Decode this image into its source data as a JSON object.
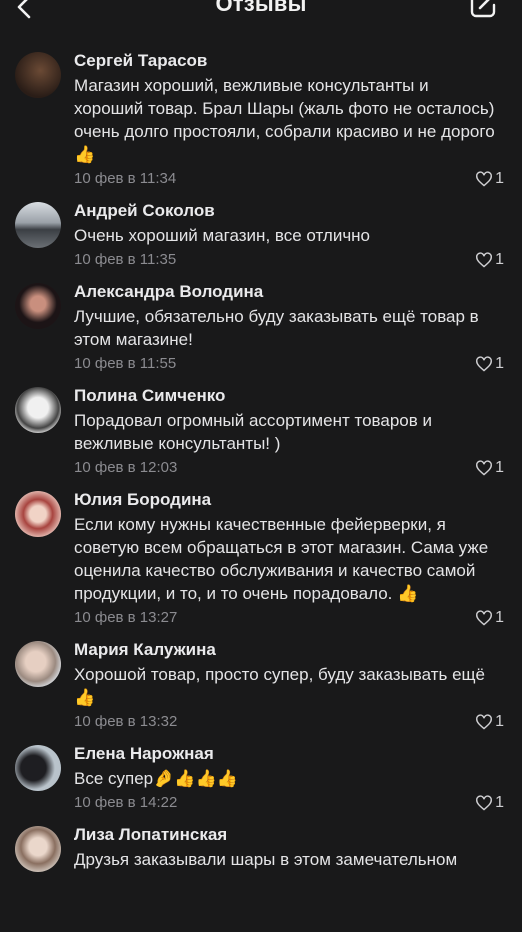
{
  "header": {
    "title": "Отзывы",
    "back_icon": "chevron-left-icon",
    "edit_icon": "edit-square-icon"
  },
  "reviews": [
    {
      "name": "Сергей Тарасов",
      "text": "Магазин хороший, вежливые консультанты и хороший товар. Брал Шары (жаль фото не осталось) очень долго простояли, собрали красиво и не дорого👍",
      "time": "10 фев в 11:34",
      "likes": "1",
      "avatar_color": "#3a2a22"
    },
    {
      "name": "Андрей Соколов",
      "text": "Очень хороший магазин, все отлично",
      "time": "10 фев в 11:35",
      "likes": "1",
      "avatar_color": "#8a8f95"
    },
    {
      "name": "Александра Володина",
      "text": "Лучшие, обязательно буду заказывать ещё товар в этом магазине!",
      "time": "10 фев в 11:55",
      "likes": "1",
      "avatar_color": "#2b2024"
    },
    {
      "name": "Полина Симченко",
      "text": "Порадовал огромный ассортимент товаров и вежливые консультанты! )",
      "time": "10 фев в 12:03",
      "likes": "1",
      "avatar_color": "#d9d9d9"
    },
    {
      "name": "Юлия Бородина",
      "text": "Если кому нужны качественные фейерверки, я советую всем обращаться в этот магазин. Сама уже оценила качество обслуживания и качество самой продукции, и то, и то очень порадовало. 👍",
      "time": "10 фев в 13:27",
      "likes": "1",
      "avatar_color": "#b98c84"
    },
    {
      "name": "Мария Калужина",
      "text": "Хорошой товар, просто супер, буду заказывать ещё👍",
      "time": "10 фев в 13:32",
      "likes": "1",
      "avatar_color": "#c8c2bd"
    },
    {
      "name": "Елена Нарожная",
      "text": "Все супер🤌👍👍👍",
      "time": "10 фев в 14:22",
      "likes": "1",
      "avatar_color": "#a9b3ba"
    },
    {
      "name": "Лиза Лопатинская",
      "text": "Друзья заказывали шары в этом замечательном",
      "time": "",
      "likes": "",
      "avatar_color": "#c9b6a6"
    }
  ]
}
